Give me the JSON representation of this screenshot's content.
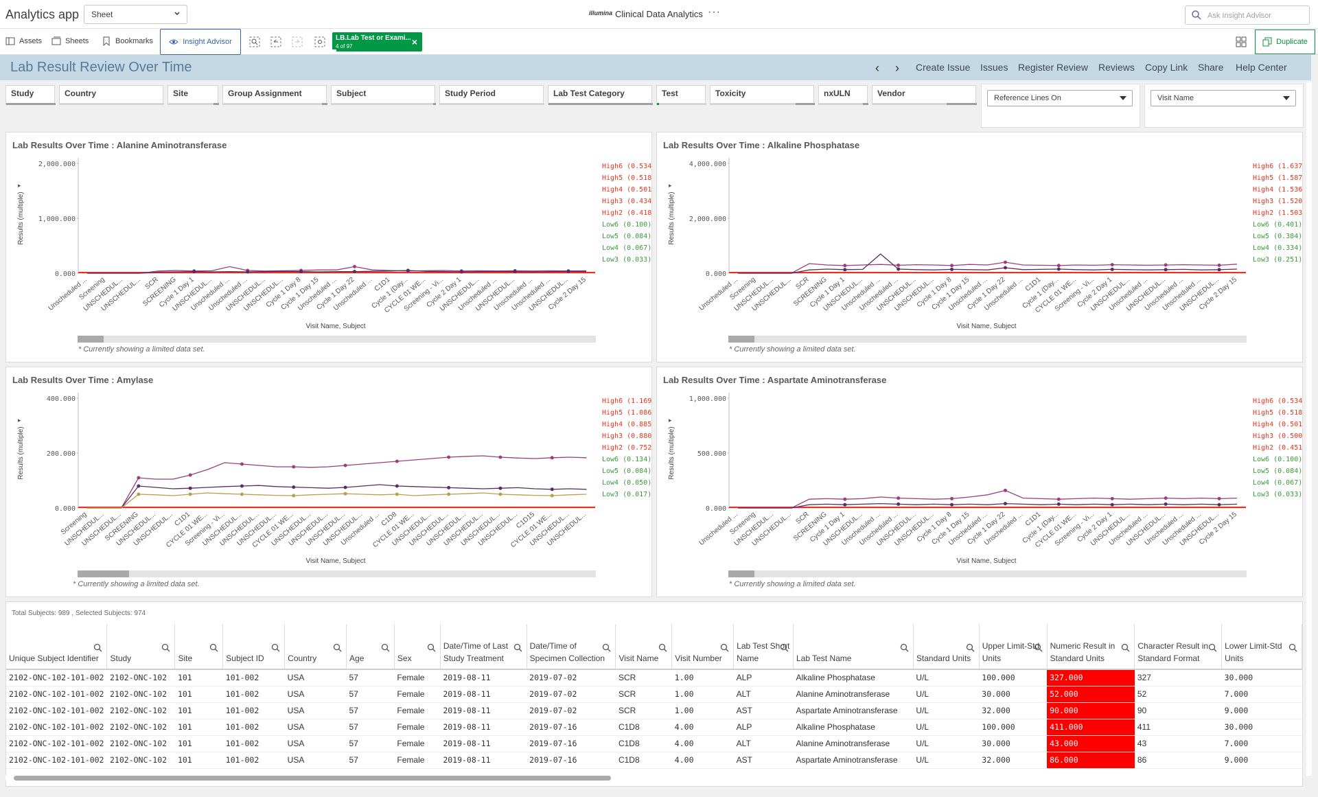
{
  "top": {
    "app_title": "Analytics app",
    "sheet_select": "Sheet",
    "logo": "illumina",
    "workspace": "Clinical Data Analytics",
    "more": "···",
    "ask_placeholder": "Ask Insight Advisor"
  },
  "toolbar": {
    "assets": "Assets",
    "sheets": "Sheets",
    "bookmarks": "Bookmarks",
    "insight": "Insight Advisor",
    "selection_field": "LB.Lab Test or Exami...",
    "selection_count": "4 of 97",
    "duplicate": "Duplicate"
  },
  "sheet": {
    "title": "Lab Result Review Over Time",
    "links": [
      "Create Issue",
      "Issues",
      "Register Review",
      "Reviews",
      "Copy Link",
      "Share",
      "Help Center"
    ]
  },
  "filters": [
    "Study",
    "Country",
    "Site",
    "Group Assignment",
    "Subject",
    "Study Period",
    "Lab Test Category",
    "Test",
    "Toxicity",
    "nxULN",
    "Vendor"
  ],
  "dropdowns": {
    "reference": "Reference Lines On",
    "visit": "Visit Name"
  },
  "chart_data": [
    {
      "type": "line",
      "title": "Lab Results Over Time : Alanine Aminotransferase",
      "ylabel": "Results (multiple)",
      "xlabel": "Visit Name, Subject",
      "y_ticks": [
        "2,000.000",
        "1,000.000",
        "0.000"
      ],
      "ylim": [
        0,
        2000
      ],
      "categories": [
        "Unscheduled ...",
        "Screening",
        "UNSCHEDUL...",
        "UNSCHEDUL...",
        "SCR",
        "SCREENING",
        "Cycle 1 Day 1",
        "UNSCHEDUL...",
        "Unscheduled ...",
        "Unscheduled ...",
        "UNSCHEDUL...",
        "UNSCHEDUL...",
        "Cycle 1 Day 8",
        "Cycle 1 Day 15",
        "Unscheduled ...",
        "Cycle 1 Day 22",
        "Unscheduled ...",
        "C1D1",
        "Cycle 1 (Day...",
        "CYCLE 01 WE...",
        "Screening - Vi...",
        "Cycle 2 Day 1",
        "UNSCHEDUL...",
        "Unscheduled ...",
        "UNSCHEDUL...",
        "Unscheduled ...",
        "Unscheduled ...",
        "UNSCHEDUL...",
        "Cycle 2 Day 15"
      ],
      "legend": [
        "High6 (0.534)",
        "High5 (0.518)",
        "High4 (0.501)",
        "High3 (0.434)",
        "High2 (0.418)",
        "Low6 (0.100)",
        "Low5 (0.084)",
        "Low4 (0.067)",
        "Low3 (0.033)"
      ],
      "series": [
        {
          "name": "",
          "values": [
            0,
            0,
            0,
            0,
            40,
            50,
            40,
            45,
            120,
            50,
            40,
            45,
            50,
            60,
            60,
            120,
            60,
            50,
            40,
            45,
            50,
            40,
            45,
            40,
            45,
            40,
            45,
            40,
            45
          ]
        },
        {
          "name": "",
          "values": [
            0,
            0,
            0,
            0,
            20,
            25,
            30,
            25,
            30,
            25,
            30,
            35,
            30,
            25,
            30,
            30,
            35,
            40,
            50,
            35,
            30,
            25,
            30,
            35,
            30,
            25,
            30,
            35,
            30
          ]
        }
      ],
      "note": "* Currently showing a limited data set."
    },
    {
      "type": "line",
      "title": "Lab Results Over Time : Alkaline Phosphatase",
      "ylabel": "Results (multiple)",
      "xlabel": "Visit Name, Subject",
      "y_ticks": [
        "4,000.000",
        "2,000.000",
        "0.000"
      ],
      "ylim": [
        0,
        4000
      ],
      "categories": [
        "Unscheduled ...",
        "Screening",
        "UNSCHEDUL...",
        "UNSCHEDUL...",
        "SCR",
        "SCREENING",
        "Cycle 1 Day 1",
        "UNSCHEDUL...",
        "Unscheduled ...",
        "Unscheduled ...",
        "UNSCHEDUL...",
        "UNSCHEDUL...",
        "Cycle 1 Day 8",
        "Cycle 1 Day 15",
        "Unscheduled ...",
        "Cycle 1 Day 22",
        "Unscheduled ...",
        "C1D1",
        "Cycle 1 (Day...",
        "CYCLE 01 WE...",
        "Screening - Vi...",
        "Cycle 2 Day 1",
        "UNSCHEDUL...",
        "Unscheduled ...",
        "UNSCHEDUL...",
        "Unscheduled ...",
        "Unscheduled ...",
        "UNSCHEDUL...",
        "Cycle 2 Day 15"
      ],
      "legend": [
        "High6 (1.637)",
        "High5 (1.587)",
        "High4 (1.536)",
        "High3 (1.520)",
        "High2 (1.503)",
        "Low6 (0.401)",
        "Low5 (0.384)",
        "Low4 (0.334)",
        "Low3 (0.251)"
      ],
      "series": [
        {
          "name": "",
          "values": [
            0,
            0,
            0,
            0,
            350,
            300,
            280,
            300,
            320,
            290,
            310,
            300,
            280,
            320,
            300,
            400,
            300,
            290,
            280,
            300,
            290,
            310,
            300,
            290,
            300,
            310,
            300,
            290,
            330
          ]
        },
        {
          "name": "",
          "values": [
            0,
            0,
            0,
            0,
            120,
            150,
            130,
            140,
            700,
            150,
            130,
            120,
            140,
            130,
            120,
            200,
            130,
            140,
            150,
            130,
            120,
            140,
            130,
            120,
            130,
            140,
            120,
            130,
            150
          ]
        }
      ],
      "note": "* Currently showing a limited data set."
    },
    {
      "type": "line",
      "title": "Lab Results Over Time : Amylase",
      "ylabel": "Results (multiple)",
      "xlabel": "Visit Name, Subject",
      "y_ticks": [
        "400.000",
        "200.000",
        "0.000"
      ],
      "ylim": [
        0,
        400
      ],
      "categories": [
        "Screening",
        "UNSCHEDUL...",
        "UNSCHEDUL...",
        "SCREENING",
        "UNSCHEDUL...",
        "UNSCHEDUL...",
        "C1D1",
        "CYCLE 01 WE...",
        "Screening - Vi...",
        "UNSCHEDUL...",
        "UNSCHEDUL...",
        "UNSCHEDUL...",
        "CYCLE 01 WE...",
        "UNSCHEDUL...",
        "UNSCHEDUL...",
        "UNSCHEDUL...",
        "UNSCHEDUL...",
        "Unscheduled ...",
        "C1D8",
        "CYCLE 01 WE...",
        "UNSCHEDUL...",
        "UNSCHEDUL...",
        "UNSCHEDUL...",
        "UNSCHEDUL...",
        "UNSCHEDUL...",
        "UNSCHEDUL...",
        "C1D15",
        "CYCLE 01 WE...",
        "UNSCHEDUL...",
        "UNSCHEDUL..."
      ],
      "legend": [
        "High6 (1.169)",
        "High5 (1.086)",
        "High4 (0.885)",
        "High3 (0.880)",
        "High2 (0.752)",
        "Low6 (0.134)",
        "Low5 (0.084)",
        "Low4 (0.050)",
        "Low3 (0.017)"
      ],
      "series": [
        {
          "name": "",
          "values": [
            0,
            0,
            0,
            110,
            105,
            105,
            120,
            140,
            165,
            160,
            155,
            150,
            150,
            148,
            150,
            155,
            160,
            165,
            170,
            175,
            180,
            185,
            188,
            190,
            185,
            182,
            180,
            183,
            185,
            183
          ]
        },
        {
          "name": "",
          "values": [
            0,
            0,
            0,
            80,
            75,
            70,
            72,
            75,
            78,
            80,
            82,
            78,
            76,
            74,
            72,
            75,
            80,
            85,
            80,
            78,
            76,
            74,
            72,
            70,
            72,
            74,
            70,
            68,
            70,
            68
          ]
        },
        {
          "name": "",
          "values": [
            0,
            0,
            0,
            50,
            48,
            45,
            50,
            55,
            52,
            50,
            48,
            46,
            45,
            48,
            50,
            52,
            50,
            48,
            50,
            45,
            48,
            50,
            52,
            55,
            50,
            48,
            46,
            45,
            48,
            50
          ]
        }
      ],
      "note": "* Currently showing a limited data set."
    },
    {
      "type": "line",
      "title": "Lab Results Over Time : Aspartate Aminotransferase",
      "ylabel": "Results (multiple)",
      "xlabel": "Visit Name, Subject",
      "y_ticks": [
        "1,000.000",
        "500.000",
        "0.000"
      ],
      "ylim": [
        0,
        1000
      ],
      "categories": [
        "Unscheduled ...",
        "Screening",
        "UNSCHEDUL...",
        "UNSCHEDUL...",
        "SCR",
        "SCREENING",
        "Cycle 1 Day 1",
        "UNSCHEDUL...",
        "Unscheduled ...",
        "Unscheduled ...",
        "UNSCHEDUL...",
        "UNSCHEDUL...",
        "Cycle 1 Day 8",
        "Cycle 1 Day 15",
        "Unscheduled ...",
        "Cycle 1 Day 22",
        "Unscheduled ...",
        "C1D1",
        "Cycle 1 (Day...",
        "CYCLE 01 WE...",
        "Screening - Vi...",
        "Cycle 2 Day 1",
        "UNSCHEDUL...",
        "Unscheduled ...",
        "UNSCHEDUL...",
        "Unscheduled ...",
        "Unscheduled ...",
        "UNSCHEDUL...",
        "Cycle 2 Day 15"
      ],
      "legend": [
        "High6 (0.534)",
        "High5 (0.518)",
        "High4 (0.501)",
        "High3 (0.500)",
        "High2 (0.451)",
        "Low6 (0.100)",
        "Low5 (0.084)",
        "Low4 (0.067)",
        "Low3 (0.033)"
      ],
      "series": [
        {
          "name": "",
          "values": [
            0,
            0,
            0,
            0,
            80,
            85,
            80,
            85,
            100,
            90,
            85,
            80,
            85,
            100,
            120,
            160,
            90,
            85,
            80,
            85,
            90,
            85,
            80,
            85,
            90,
            85,
            90,
            85,
            90
          ]
        },
        {
          "name": "",
          "values": [
            0,
            0,
            0,
            0,
            30,
            35,
            30,
            35,
            40,
            35,
            30,
            35,
            30,
            35,
            30,
            40,
            35,
            30,
            35,
            30,
            35,
            30,
            35,
            30,
            35,
            30,
            35,
            30,
            35
          ]
        }
      ],
      "note": "* Currently showing a limited data set."
    }
  ],
  "table": {
    "subject_count": "Total Subjects: 989 , Selected Subjects: 974",
    "columns": [
      "Unique Subject Identifier",
      "Study",
      "Site",
      "Subject ID",
      "Country",
      "Age",
      "Sex",
      "Date/Time of Last Study Treatment",
      "Date/Time of Specimen Collection",
      "Visit Name",
      "Visit Number",
      "Lab Test Short Name",
      "Lab Test Name",
      "Standard Units",
      "Upper Limit-Std Units",
      "Numeric Result in Standard Units",
      "Character Result in Standard Format",
      "Lower Limit-Std Units"
    ],
    "rows": [
      [
        "2102-ONC-102-101-002",
        "2102-ONC-102",
        "101",
        "101-002",
        "USA",
        "57",
        "Female",
        "2019-08-11",
        "2019-07-02",
        "SCR",
        "1.00",
        "ALP",
        "Alkaline Phosphatase",
        "U/L",
        "100.000",
        "327.000",
        "327",
        "30.000"
      ],
      [
        "2102-ONC-102-101-002",
        "2102-ONC-102",
        "101",
        "101-002",
        "USA",
        "57",
        "Female",
        "2019-08-11",
        "2019-07-02",
        "SCR",
        "1.00",
        "ALT",
        "Alanine Aminotransferase",
        "U/L",
        "30.000",
        "52.000",
        "52",
        "7.000"
      ],
      [
        "2102-ONC-102-101-002",
        "2102-ONC-102",
        "101",
        "101-002",
        "USA",
        "57",
        "Female",
        "2019-08-11",
        "2019-07-02",
        "SCR",
        "1.00",
        "AST",
        "Aspartate Aminotransferase",
        "U/L",
        "32.000",
        "90.000",
        "90",
        "9.000"
      ],
      [
        "2102-ONC-102-101-002",
        "2102-ONC-102",
        "101",
        "101-002",
        "USA",
        "57",
        "Female",
        "2019-08-11",
        "2019-07-16",
        "C1D8",
        "4.00",
        "ALP",
        "Alkaline Phosphatase",
        "U/L",
        "100.000",
        "411.000",
        "411",
        "30.000"
      ],
      [
        "2102-ONC-102-101-002",
        "2102-ONC-102",
        "101",
        "101-002",
        "USA",
        "57",
        "Female",
        "2019-08-11",
        "2019-07-16",
        "C1D8",
        "4.00",
        "ALT",
        "Alanine Aminotransferase",
        "U/L",
        "30.000",
        "43.000",
        "43",
        "7.000"
      ],
      [
        "2102-ONC-102-101-002",
        "2102-ONC-102",
        "101",
        "101-002",
        "USA",
        "57",
        "Female",
        "2019-08-11",
        "2019-07-16",
        "C1D8",
        "4.00",
        "AST",
        "Aspartate Aminotransferase",
        "U/L",
        "32.000",
        "86.000",
        "86",
        "9.000"
      ]
    ]
  },
  "colors": {
    "accent": "#009845",
    "high": "#e8331c",
    "low": "#3a9a3a",
    "highlight": "#ff0000",
    "header": "#c5d8e6"
  }
}
